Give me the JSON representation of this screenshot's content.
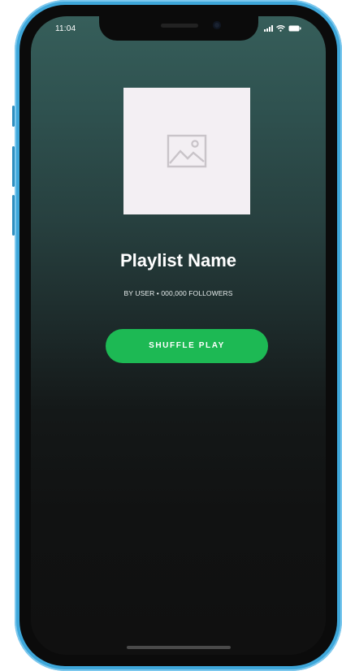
{
  "status_bar": {
    "time": "11:04",
    "icons": [
      "signal-icon",
      "wifi-icon",
      "battery-icon"
    ]
  },
  "playlist": {
    "cover_icon": "image-placeholder-icon",
    "name": "Playlist Name",
    "meta": "BY USER • 000,000 FOLLOWERS"
  },
  "actions": {
    "shuffle_play_label": "SHUFFLE PLAY"
  },
  "colors": {
    "accent_green": "#1db954",
    "device_frame": "#3ea7da",
    "cover_placeholder": "#f3eff3",
    "background_top": "#365e5a",
    "background_bottom": "#101010"
  }
}
